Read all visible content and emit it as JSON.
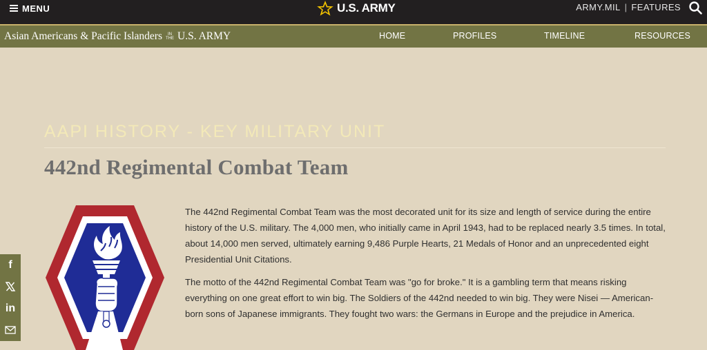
{
  "topbar": {
    "menu_label": "MENU",
    "brand_label": "U.S. ARMY",
    "links": [
      "ARMY.MIL",
      "FEATURES"
    ],
    "separator": "|"
  },
  "navbar": {
    "site_title_part1": "Asian Americans & Pacific Islanders",
    "site_title_small_1": "IN",
    "site_title_small_2": "THE",
    "site_title_part2": "U.S. ARMY",
    "items": [
      {
        "label": "HOME"
      },
      {
        "label": "PROFILES"
      },
      {
        "label": "TIMELINE"
      },
      {
        "label": "RESOURCES"
      }
    ]
  },
  "main": {
    "kicker": "AAPI HISTORY - KEY MILITARY UNIT",
    "title": "442nd Regimental Combat Team",
    "paragraphs": [
      "The 442nd Regimental Combat Team was the most decorated unit for its size and length of service during the entire history of the U.S. military. The 4,000 men, who initially came in April 1943, had to be replaced nearly 3.5 times. In total, about 14,000 men served, ultimately earning 9,486 Purple Hearts, 21 Medals of Honor and an unprecedented eight Presidential Unit Citations.",
      "The motto of the 442nd Regimental Combat Team was \"go for broke.\" It is a gambling term that means risking everything on one great effort to win big. The Soldiers of the 442nd needed to win big. They were Nisei — American-born sons of Japanese immigrants. They fought two wars: the Germans in Europe and the prejudice in America."
    ]
  },
  "share": {
    "items": [
      {
        "icon": "facebook-icon",
        "glyph": "f"
      },
      {
        "icon": "x-icon"
      },
      {
        "icon": "linkedin-icon",
        "glyph": "in"
      },
      {
        "icon": "email-icon"
      }
    ]
  },
  "colors": {
    "topbar_bg": "#221f20",
    "nav_bg": "#727444",
    "page_bg": "#e1d6c0",
    "kicker": "#f3e9b8",
    "patch_red": "#b0282f",
    "patch_blue": "#1f2c96",
    "star_gold": "#f2c200"
  }
}
